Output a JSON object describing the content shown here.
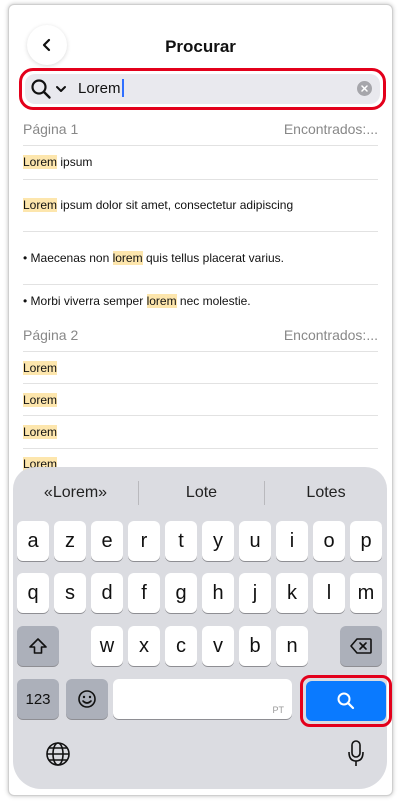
{
  "header": {
    "title": "Procurar"
  },
  "search": {
    "value": "Lorem"
  },
  "results": {
    "page1": {
      "label": "Página 1",
      "found": "Encontrados:..."
    },
    "page2": {
      "label": "Página 2",
      "found": "Encontrados:..."
    },
    "rows": [
      {
        "pre": "",
        "match": "Lorem",
        "post": " ipsum"
      },
      {
        "pre": "",
        "match": "Lorem",
        "post": " ipsum dolor sit amet, consectetur adipiscing"
      },
      {
        "pre": "• Maecenas non ",
        "match": "lorem",
        "post": " quis tellus placerat varius."
      },
      {
        "pre": "• Morbi viverra semper ",
        "match": "lorem",
        "post": " nec molestie."
      },
      {
        "pre": "",
        "match": "Lorem",
        "post": ""
      },
      {
        "pre": "",
        "match": "Lorem",
        "post": ""
      },
      {
        "pre": "",
        "match": "Lorem",
        "post": ""
      },
      {
        "pre": "",
        "match": "Lorem",
        "post": ""
      }
    ]
  },
  "keyboard": {
    "suggestions": [
      "«Lorem»",
      "Lote",
      "Lotes"
    ],
    "row1": [
      "a",
      "z",
      "e",
      "r",
      "t",
      "y",
      "u",
      "i",
      "o",
      "p"
    ],
    "row2": [
      "q",
      "s",
      "d",
      "f",
      "g",
      "h",
      "j",
      "k",
      "l",
      "m"
    ],
    "row3": [
      "w",
      "x",
      "c",
      "v",
      "b",
      "n"
    ],
    "numbers_label": "123",
    "language_label": "PT"
  },
  "colors": {
    "accent": "#0a7aff",
    "highlight": "#fde6ad",
    "annotation": "#e3001b"
  }
}
